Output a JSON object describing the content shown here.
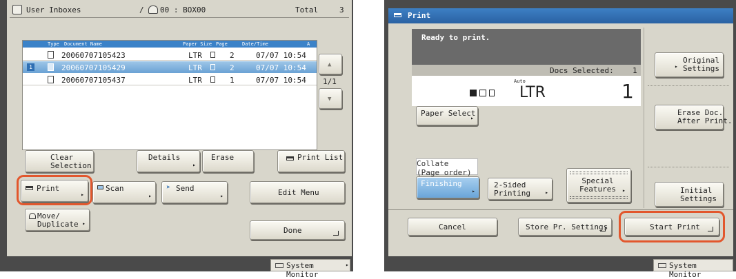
{
  "left": {
    "header": {
      "title": "User Inboxes",
      "separator": "/",
      "box_label": "00 : BOX00",
      "total_label": "Total",
      "total_value": "3"
    },
    "table": {
      "columns": [
        "Type",
        "Document Name",
        "Paper Size",
        "Page",
        "Date/Time",
        "A"
      ],
      "rows": [
        {
          "name": "20060707105423",
          "paper": "LTR",
          "pages": "2",
          "datetime": "07/07 10:54"
        },
        {
          "name": "20060707105429",
          "paper": "LTR",
          "pages": "2",
          "datetime": "07/07 10:54",
          "selected": true,
          "number": "1"
        },
        {
          "name": "20060707105437",
          "paper": "LTR",
          "pages": "1",
          "datetime": "07/07 10:54"
        }
      ],
      "page_indicator": "1/1"
    },
    "buttons": {
      "clear_selection": "Clear\nSelection",
      "details": "Details",
      "erase": "Erase",
      "print_list": "Print List",
      "print": "Print",
      "scan": "Scan",
      "send": "Send",
      "edit_menu": "Edit Menu",
      "move_duplicate": "Move/\nDuplicate",
      "done": "Done"
    },
    "system_monitor": "System Monitor"
  },
  "right": {
    "header": {
      "title": "Print"
    },
    "status": "Ready to print.",
    "docs_selected_label": "Docs Selected:",
    "docs_selected_value": "1",
    "auto_label": "Auto",
    "paper_size": "LTR",
    "copies": "1",
    "buttons": {
      "original_settings": "Original\nSettings",
      "paper_select": "Paper Select",
      "erase_doc_after_print": "Erase Doc.\nAfter Print.",
      "collate": "Collate\n(Page order)",
      "finishing": "Finishing",
      "two_sided_printing": "2-Sided\nPrinting",
      "special_features": "Special\nFeatures",
      "initial_settings": "Initial\nSettings",
      "cancel": "Cancel",
      "store_pr_settings": "Store Pr. Settings",
      "start_print": "Start Print"
    },
    "system_monitor": "System Monitor"
  },
  "colors": {
    "highlight_ring": "#e2572d",
    "selected_row": "#8bb7df",
    "header_bar": "#2f6fb3"
  }
}
